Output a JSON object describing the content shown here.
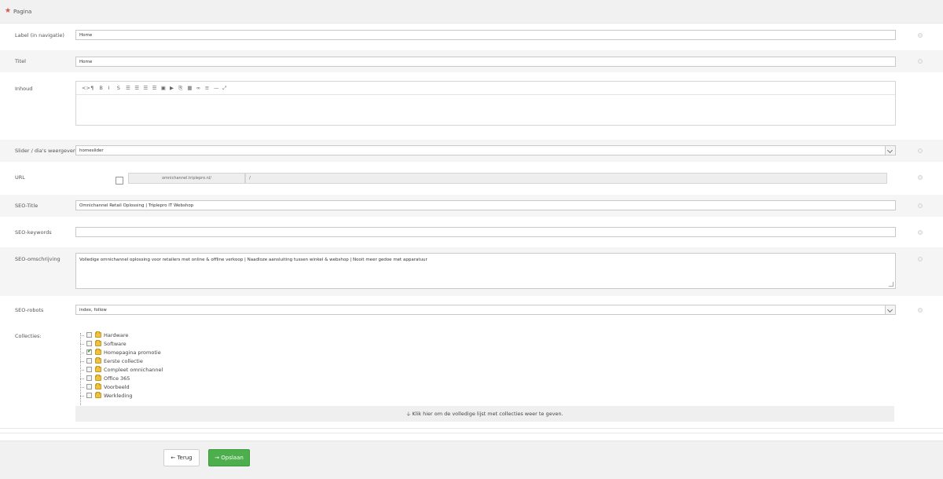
{
  "section": {
    "title": "Pagina"
  },
  "fields": {
    "label": {
      "label": "Label (in navigatie)",
      "value": "Home"
    },
    "titel": {
      "label": "Titel",
      "value": "Home"
    },
    "inhoud": {
      "label": "Inhoud"
    },
    "slider": {
      "label": "Slider / dia's weergeven",
      "value": "homeslider"
    },
    "url": {
      "label": "URL",
      "prefix": "omnichannel.triplepro.nl/",
      "path": "/"
    },
    "seo_title": {
      "label": "SEO-Title",
      "value": "Omnichannel Retail Oplossing | Triplepro IT Webshop"
    },
    "seo_keywords": {
      "label": "SEO-keywords",
      "value": ""
    },
    "seo_omschrijving": {
      "label": "SEO-omschrijving",
      "value": "Volledige omnichannel oplossing voor retailers met online & offline verkoop | Naadloze aansluiting tussen winkel & webshop | Nooit meer gedoe met apparatuur"
    },
    "seo_robots": {
      "label": "SEO-robots",
      "value": "index, follow"
    },
    "collecties": {
      "label": "Collecties:"
    }
  },
  "editor_toolbar": [
    {
      "icon": "code-icon",
      "glyph": "<>"
    },
    {
      "icon": "paragraph-icon",
      "glyph": "¶"
    },
    {
      "icon": "bold-icon",
      "glyph": "B"
    },
    {
      "icon": "italic-icon",
      "glyph": "I"
    },
    {
      "icon": "strikethrough-icon",
      "glyph": "S"
    },
    {
      "icon": "unordered-list-icon",
      "glyph": "☰"
    },
    {
      "icon": "ordered-list-icon",
      "glyph": "☰"
    },
    {
      "icon": "outdent-icon",
      "glyph": "☰"
    },
    {
      "icon": "indent-icon",
      "glyph": "☰"
    },
    {
      "icon": "image-icon",
      "glyph": "▣"
    },
    {
      "icon": "video-icon",
      "glyph": "▶"
    },
    {
      "icon": "file-icon",
      "glyph": "⎘"
    },
    {
      "icon": "table-icon",
      "glyph": "▦"
    },
    {
      "icon": "link-icon",
      "glyph": "∞"
    },
    {
      "icon": "align-icon",
      "glyph": "≡"
    },
    {
      "icon": "horizontal-rule-icon",
      "glyph": "—"
    },
    {
      "icon": "fullscreen-icon",
      "glyph": "⤢"
    }
  ],
  "collections": [
    {
      "name": "Hardware",
      "checked": false
    },
    {
      "name": "Software",
      "checked": false
    },
    {
      "name": "Homepagina promotie",
      "checked": true
    },
    {
      "name": "Eerste collectie",
      "checked": false
    },
    {
      "name": "Compleet omnichannel",
      "checked": false
    },
    {
      "name": "Office 365",
      "checked": false
    },
    {
      "name": "Voorbeeld",
      "checked": false
    },
    {
      "name": "Werkleding",
      "checked": false
    }
  ],
  "more_collections_label": "Klik hier om de volledige lijst met collecties weer te geven.",
  "buttons": {
    "back": "Terug",
    "save": "Opslaan"
  },
  "colors": {
    "required_star": "#d9534f",
    "save_button": "#4cae4c",
    "row_shade": "#f5f5f5"
  }
}
